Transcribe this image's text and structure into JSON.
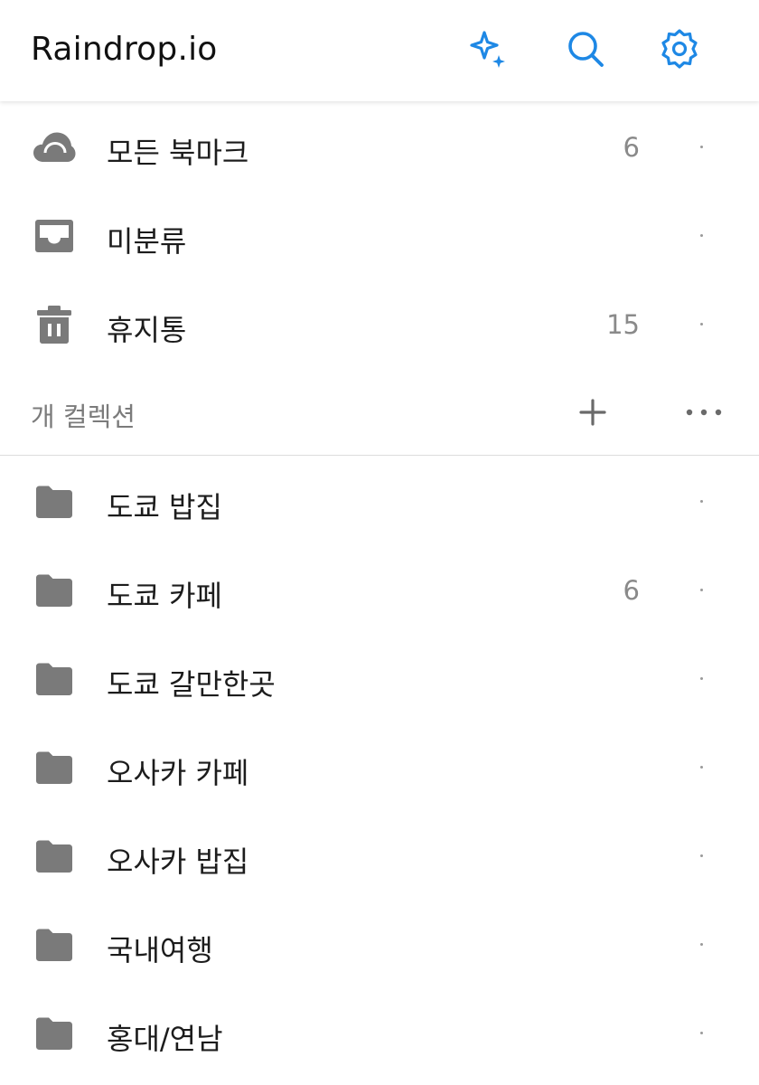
{
  "header": {
    "title": "Raindrop.io",
    "buttons": [
      {
        "icon": "sparkle-icon"
      },
      {
        "icon": "search-icon"
      },
      {
        "icon": "gear-icon"
      }
    ],
    "accent_color": "#1e88e5"
  },
  "system_items": [
    {
      "icon": "cloud-icon",
      "label": "모든 북마크",
      "count": "6"
    },
    {
      "icon": "inbox-icon",
      "label": "미분류",
      "count": ""
    },
    {
      "icon": "trash-icon",
      "label": "휴지통",
      "count": "15"
    }
  ],
  "section": {
    "title": "개 컬렉션",
    "add_icon": "plus-icon",
    "more_icon": "more-icon"
  },
  "collections": [
    {
      "icon": "folder-icon",
      "label": "도쿄 밥집",
      "count": ""
    },
    {
      "icon": "folder-icon",
      "label": "도쿄 카페",
      "count": "6"
    },
    {
      "icon": "folder-icon",
      "label": "도쿄 갈만한곳",
      "count": ""
    },
    {
      "icon": "folder-icon",
      "label": "오사카 카페",
      "count": ""
    },
    {
      "icon": "folder-icon",
      "label": "오사카 밥집",
      "count": ""
    },
    {
      "icon": "folder-icon",
      "label": "국내여행",
      "count": ""
    },
    {
      "icon": "folder-icon",
      "label": "홍대/연남",
      "count": ""
    }
  ],
  "colors": {
    "icon_gray": "#7a7a7a",
    "text": "#1c1c1c",
    "muted": "#8a8a8a"
  }
}
